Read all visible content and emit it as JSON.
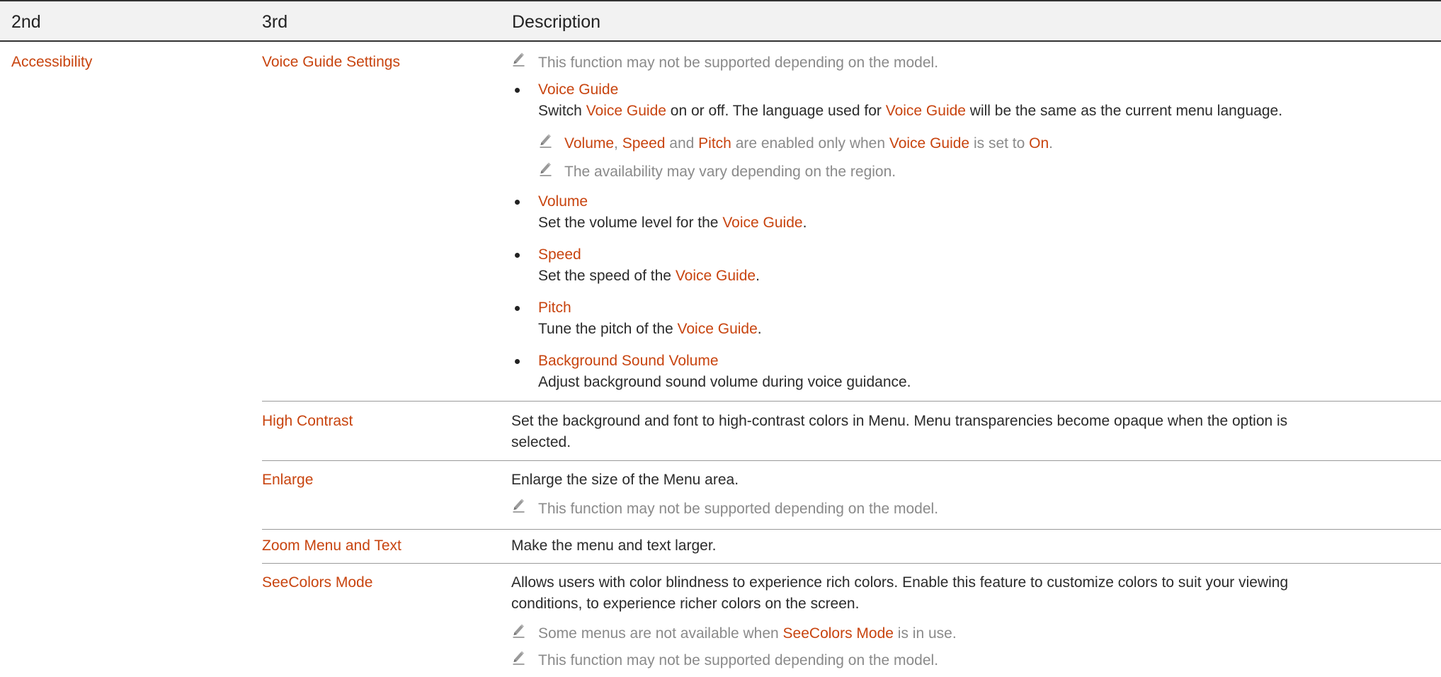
{
  "header": {
    "col1": "2nd",
    "col2": "3rd",
    "col3": "Description"
  },
  "category": "Accessibility",
  "voice_guide_settings": {
    "name": "Voice Guide Settings",
    "note_model": "This function may not be supported depending on the model.",
    "voice_guide": {
      "title": "Voice Guide",
      "desc_a": "Switch ",
      "desc_b": "Voice Guide",
      "desc_c": " on or off. The language used for ",
      "desc_d": "Voice Guide",
      "desc_e": " will be the same as the current menu language.",
      "note1_volume": "Volume",
      "note1_sep1": ", ",
      "note1_speed": "Speed",
      "note1_and": " and ",
      "note1_pitch": "Pitch",
      "note1_mid": " are enabled only when ",
      "note1_vg": "Voice Guide",
      "note1_set": " is set to ",
      "note1_on": "On",
      "note1_end": ".",
      "note2": "The availability may vary depending on the region."
    },
    "volume": {
      "title": "Volume",
      "desc_a": "Set the volume level for the ",
      "desc_b": "Voice Guide",
      "desc_c": "."
    },
    "speed": {
      "title": "Speed",
      "desc_a": "Set the speed of the ",
      "desc_b": "Voice Guide",
      "desc_c": "."
    },
    "pitch": {
      "title": "Pitch",
      "desc_a": "Tune the pitch of the ",
      "desc_b": "Voice Guide",
      "desc_c": "."
    },
    "background": {
      "title": "Background Sound Volume",
      "desc": "Adjust background sound volume during voice guidance."
    }
  },
  "high_contrast": {
    "name": "High Contrast",
    "desc_line1": "Set the background and font to high-contrast colors in Menu. Menu transparencies become opaque when the option is",
    "desc_line2": "selected."
  },
  "enlarge": {
    "name": "Enlarge",
    "desc": "Enlarge the size of the Menu area.",
    "note": "This function may not be supported depending on the model."
  },
  "zoom": {
    "name": "Zoom Menu and Text",
    "desc": "Make the menu and text larger."
  },
  "seecolors": {
    "name": "SeeColors Mode",
    "desc_line1": "Allows users with color blindness to experience rich colors. Enable this feature to customize colors to suit your viewing",
    "desc_line2": "conditions, to experience richer colors on the screen.",
    "note1_a": "Some menus are not available when ",
    "note1_b": "SeeColors Mode",
    "note1_c": " is in use.",
    "note2": "This function may not be supported depending on the model."
  },
  "icons": {
    "note": "pencil-note-icon",
    "bullet": "bullet-dot"
  },
  "colors": {
    "term": "#c8440f",
    "note": "#8a8a8a",
    "text": "#2b2b2b",
    "header_bg": "#f2f2f2"
  }
}
